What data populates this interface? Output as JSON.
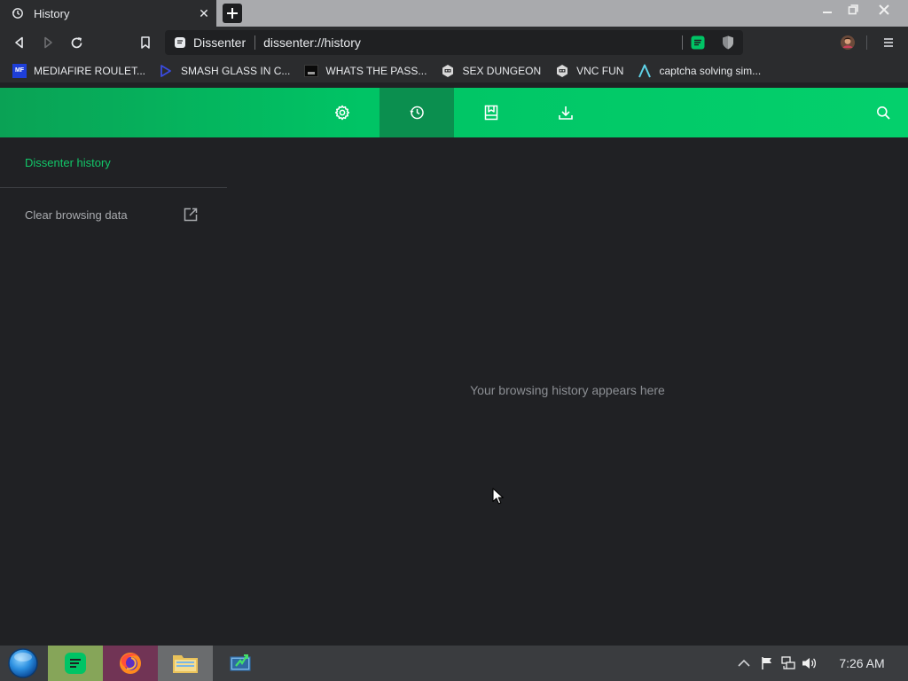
{
  "tab": {
    "title": "History",
    "icon": "history-icon",
    "close_symbol": "✕"
  },
  "window_controls": [
    "minimize",
    "restore",
    "close"
  ],
  "toolbar": {
    "site_label": "Dissenter",
    "url": "dissenter://history"
  },
  "bookmarks": [
    {
      "label": "MEDIAFIRE ROULET...",
      "icon": "mediafire-icon",
      "icon_text": "MF"
    },
    {
      "label": "SMASH GLASS IN C...",
      "icon": "angle-bracket-icon"
    },
    {
      "label": "WHATS THE PASS...",
      "icon": "terminal-icon"
    },
    {
      "label": "SEX DUNGEON",
      "icon": "robot-icon"
    },
    {
      "label": "VNC FUN",
      "icon": "robot-icon"
    },
    {
      "label": "captcha solving sim...",
      "icon": "a-logo-icon"
    }
  ],
  "header": {
    "nav": [
      {
        "name": "settings",
        "icon": "gear-icon",
        "active": false
      },
      {
        "name": "history",
        "icon": "history-icon",
        "active": true
      },
      {
        "name": "bookmarks",
        "icon": "bookmark-icon",
        "active": false
      },
      {
        "name": "downloads",
        "icon": "download-icon",
        "active": false
      }
    ],
    "search_icon": "search-icon"
  },
  "sidebar": {
    "title": "Dissenter history",
    "clear_label": "Clear browsing data"
  },
  "main": {
    "empty_message": "Your browsing history appears here"
  },
  "taskbar": {
    "apps": [
      "start-orb",
      "dissenter-app",
      "firefox-app",
      "file-explorer-app",
      "network-monitor-app"
    ],
    "clock": "7:26 AM"
  },
  "colors": {
    "accent_green": "#00c465",
    "active_nav": "#0b8f4f",
    "sidebar_title": "#12c769",
    "page_bg": "#202124"
  }
}
